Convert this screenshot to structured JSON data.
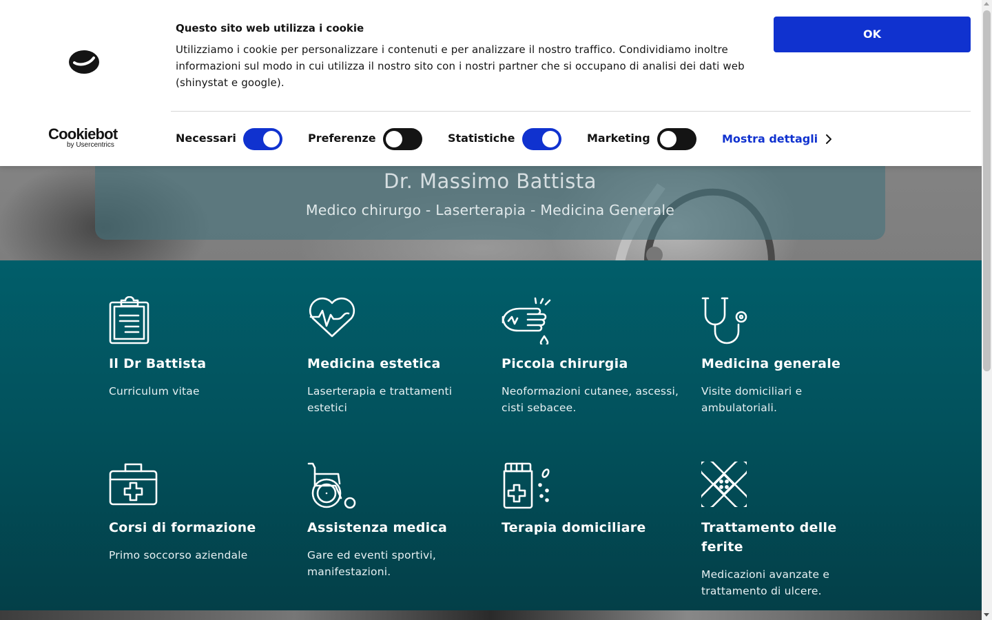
{
  "cookie_banner": {
    "title": "Questo sito web utilizza i cookie",
    "text": "Utilizziamo i cookie per personalizzare i contenuti e per analizzare il nostro traffico. Condividiamo inoltre informazioni sul modo in cui utilizza il nostro sito con i nostri partner che si occupano di analisi dei dati web (shinystat e google).",
    "ok_label": "OK",
    "brand_name": "Cookiebot",
    "brand_sub": "by Usercentrics",
    "toggles": [
      {
        "label": "Necessari",
        "checked": true
      },
      {
        "label": "Preferenze",
        "checked": false
      },
      {
        "label": "Statistiche",
        "checked": true
      },
      {
        "label": "Marketing",
        "checked": false
      }
    ],
    "details_label": "Mostra dettagli",
    "accent_color": "#1032cf"
  },
  "hero": {
    "title": "Dr. Massimo Battista",
    "subtitle": "Medico chirurgo - Laserterapia - Medicina Generale"
  },
  "services": [
    {
      "title": "Il Dr Battista",
      "desc": "Curriculum vitae",
      "icon": "clipboard-icon"
    },
    {
      "title": "Medicina estetica",
      "desc": "Laserterapia e trattamenti estetici",
      "icon": "heart-pulse-icon"
    },
    {
      "title": "Piccola chirurgia",
      "desc": "Neoformazioni cutanee, ascessi, cisti sebacee.",
      "icon": "pinch-drop-icon"
    },
    {
      "title": "Medicina generale",
      "desc": "Visite domiciliari e ambulatoriali.",
      "icon": "stethoscope-icon"
    },
    {
      "title": "Corsi di formazione",
      "desc": "Primo soccorso aziendale",
      "icon": "first-aid-kit-icon"
    },
    {
      "title": "Assistenza medica",
      "desc": "Gare ed eventi sportivi, manifestazioni.",
      "icon": "wheelchair-icon"
    },
    {
      "title": "Terapia domiciliare",
      "desc": "",
      "icon": "medicine-bottle-icon"
    },
    {
      "title": "Trattamento delle ferite",
      "desc": "Medicazioni avanzate e trattamento di ulcere.",
      "icon": "bandage-icon"
    }
  ],
  "colors": {
    "services_bg": "#015e6a",
    "hero_box": "#46737d"
  }
}
